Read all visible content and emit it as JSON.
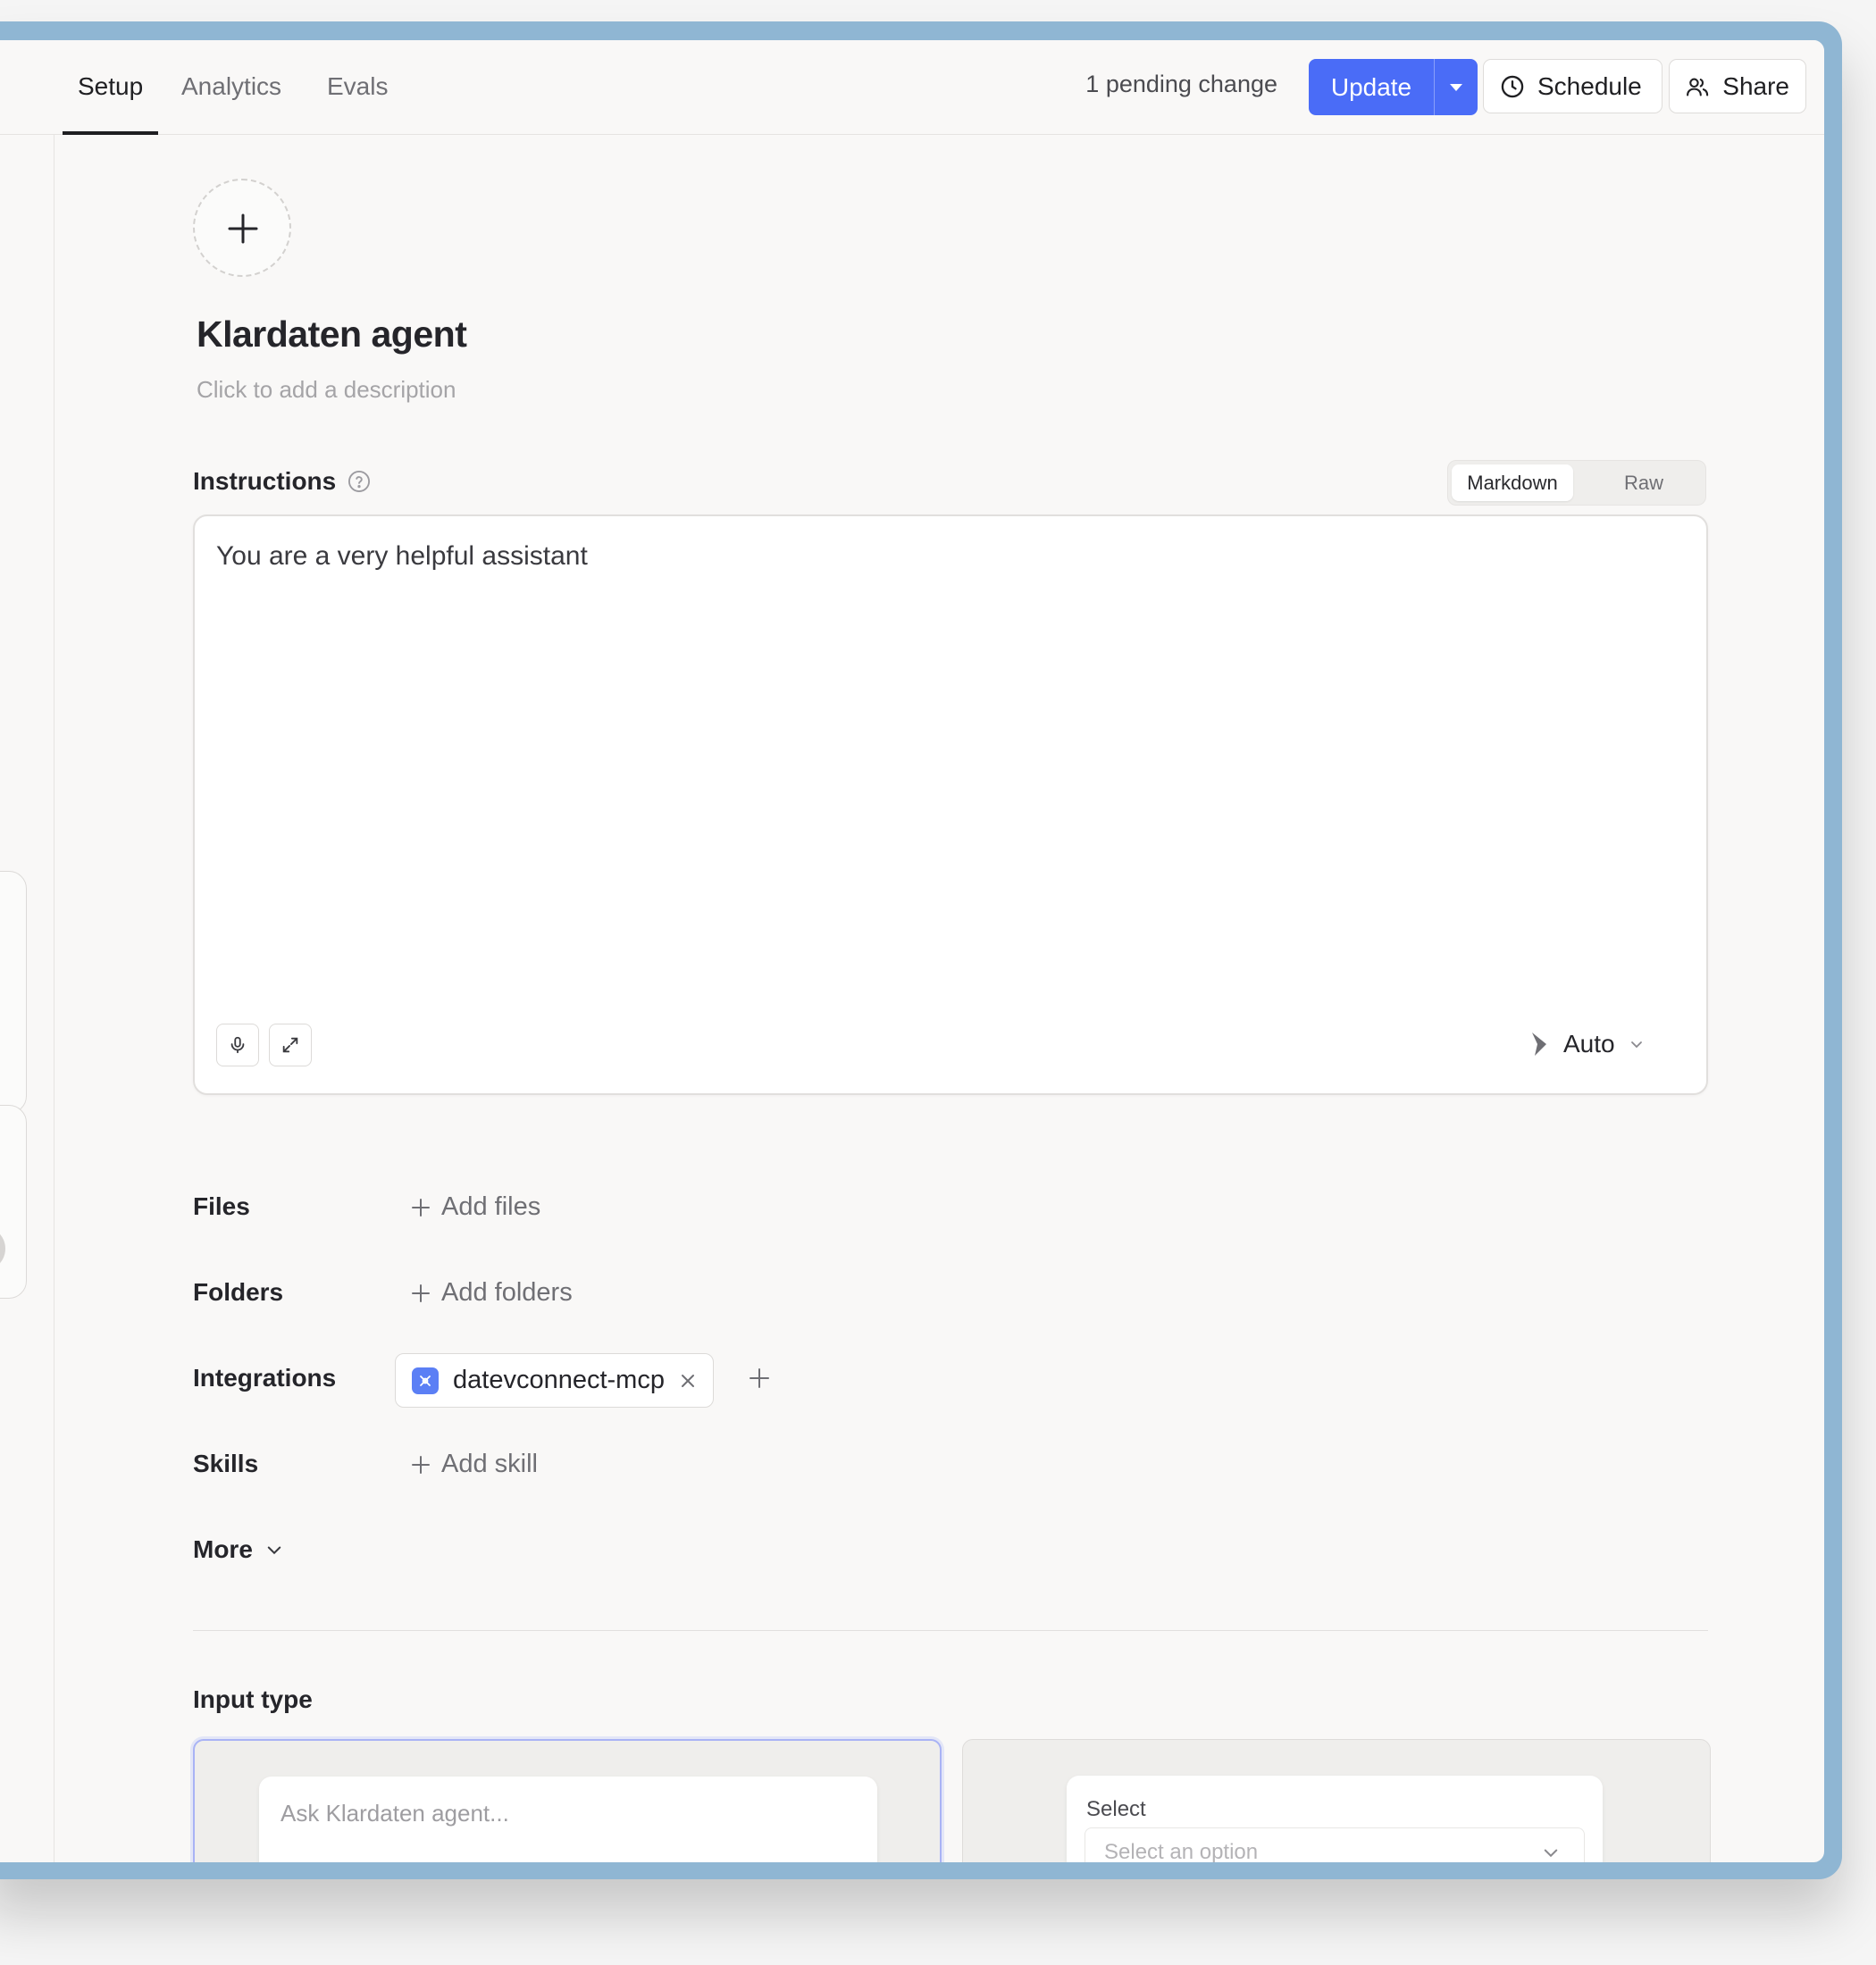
{
  "header": {
    "tabs": [
      {
        "label": "Setup",
        "active": true
      },
      {
        "label": "Analytics",
        "active": false
      },
      {
        "label": "Evals",
        "active": false
      }
    ],
    "pending_text": "1 pending change",
    "update_label": "Update",
    "schedule_label": "Schedule",
    "share_label": "Share"
  },
  "agent": {
    "name": "Klardaten agent",
    "description_placeholder": "Click to add a description"
  },
  "instructions": {
    "label": "Instructions",
    "modes": [
      "Markdown",
      "Raw"
    ],
    "active_mode": "Markdown",
    "text": "You are a very helpful assistant",
    "model": "Auto"
  },
  "resources": {
    "files_label": "Files",
    "add_files": "Add files",
    "folders_label": "Folders",
    "add_folders": "Add folders",
    "integrations_label": "Integrations",
    "integrations": [
      "datevconnect-mcp"
    ],
    "skills_label": "Skills",
    "add_skill": "Add skill",
    "more_label": "More"
  },
  "input_type": {
    "label": "Input type",
    "chat_placeholder": "Ask Klardaten agent...",
    "select_label": "Select",
    "select_placeholder": "Select an option"
  },
  "colors": {
    "accent": "#4a6cf7",
    "frame": "#8fb6d3",
    "background": "#f9f8f7"
  }
}
